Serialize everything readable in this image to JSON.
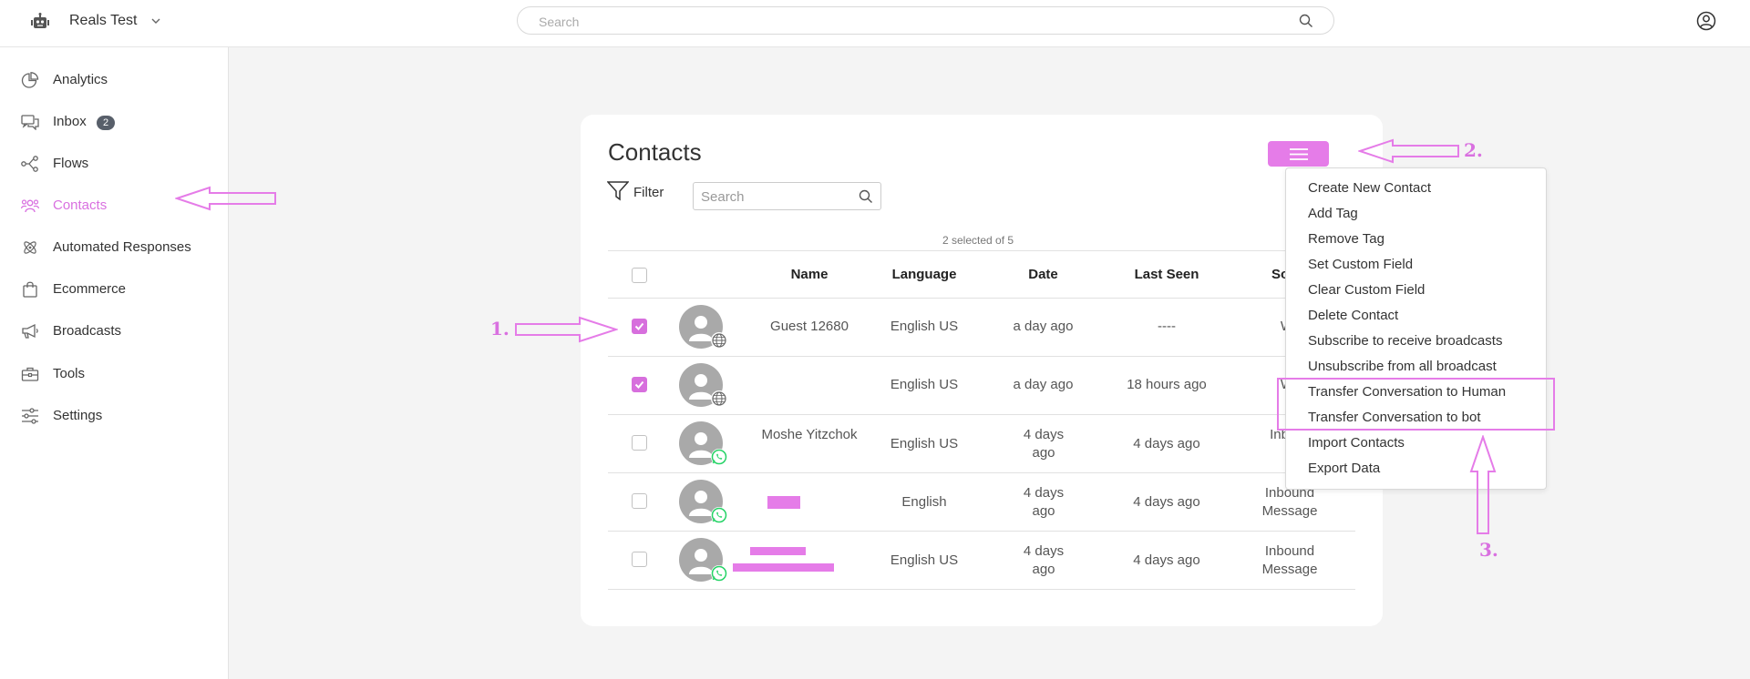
{
  "topbar": {
    "workspace_name": "Reals Test",
    "search_placeholder": "Search"
  },
  "sidebar": {
    "items": [
      {
        "label": "Analytics",
        "icon": "pie-chart-icon"
      },
      {
        "label": "Inbox",
        "icon": "inbox-chat-icon",
        "badge": "2"
      },
      {
        "label": "Flows",
        "icon": "flows-icon"
      },
      {
        "label": "Contacts",
        "icon": "contacts-icon",
        "active": true
      },
      {
        "label": "Automated Responses",
        "icon": "atom-icon"
      },
      {
        "label": "Ecommerce",
        "icon": "shopping-bag-icon"
      },
      {
        "label": "Broadcasts",
        "icon": "megaphone-icon"
      },
      {
        "label": "Tools",
        "icon": "toolbox-icon"
      },
      {
        "label": "Settings",
        "icon": "sliders-icon"
      }
    ]
  },
  "contacts": {
    "title": "Contacts",
    "filter_label": "Filter",
    "search_placeholder": "Search",
    "selected_count": "2 selected of 5",
    "columns": [
      "Name",
      "Language",
      "Date",
      "Last Seen",
      "So"
    ],
    "rows": [
      {
        "checked": true,
        "channel": "web",
        "name": "Guest 12680",
        "language": "English US",
        "date": "a day ago",
        "last_seen": "----",
        "source": "We"
      },
      {
        "checked": true,
        "channel": "web",
        "name": "",
        "language": "English US",
        "date": "a day ago",
        "last_seen": "18 hours ago",
        "source": "We"
      },
      {
        "checked": false,
        "channel": "whatsapp",
        "name": "Moshe Yitzchok",
        "language": "English US",
        "date": "4 days ago",
        "last_seen": "4 days ago",
        "source": "Inb Me"
      },
      {
        "checked": false,
        "channel": "whatsapp",
        "name": "",
        "language": "English",
        "date": "4 days ago",
        "last_seen": "4 days ago",
        "source": "Inbound Message"
      },
      {
        "checked": false,
        "channel": "whatsapp",
        "name": "",
        "language": "English US",
        "date": "4 days ago",
        "last_seen": "4 days ago",
        "source": "Inbound Message"
      }
    ]
  },
  "actions_menu": {
    "items": [
      "Create New Contact",
      "Add Tag",
      "Remove Tag",
      "Set Custom Field",
      "Clear Custom Field",
      "Delete Contact",
      "Subscribe to receive broadcasts",
      "Unsubscribe from all broadcast",
      "Transfer Conversation to Human",
      "Transfer Conversation to bot",
      "Import Contacts",
      "Export Data"
    ]
  },
  "annotations": {
    "step1": "1.",
    "step2": "2.",
    "step3": "3.",
    "color": "#e57ce8"
  },
  "colors": {
    "accent": "#e57ce8",
    "checkbox_checked": "#d76fdd",
    "badge": "#585f6a",
    "whatsapp": "#25d366"
  }
}
